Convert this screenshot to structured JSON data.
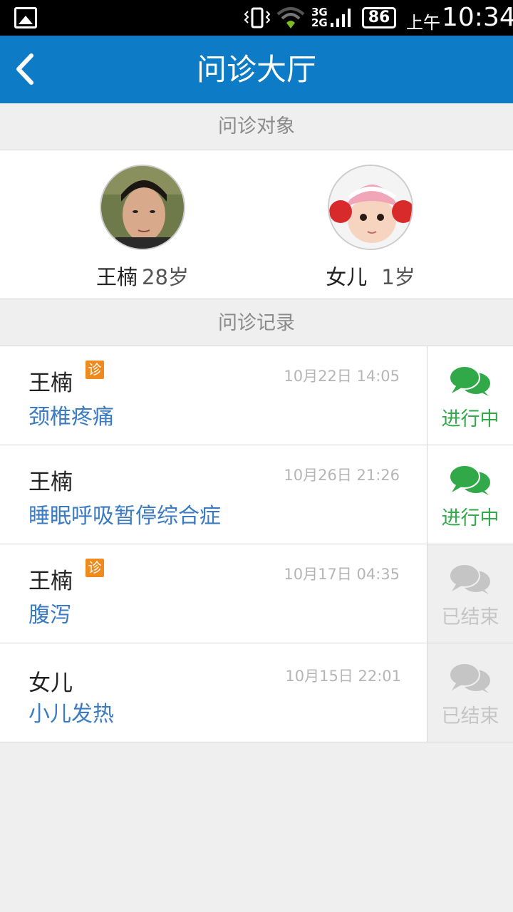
{
  "status_bar": {
    "network": "3G\n2G",
    "battery": "86",
    "ampm": "上午",
    "time": "10:34"
  },
  "header": {
    "title": "问诊大厅"
  },
  "patients_section": {
    "label": "问诊对象",
    "items": [
      {
        "name": "王楠",
        "age": "28岁"
      },
      {
        "name": "女儿",
        "age": "1岁"
      }
    ]
  },
  "records_section": {
    "label": "问诊记录",
    "items": [
      {
        "name": "王楠",
        "badge": "诊",
        "time": "10月22日 14:05",
        "diagnosis": "颈椎疼痛",
        "status": "进行中",
        "state": "active"
      },
      {
        "name": "王楠",
        "badge": "",
        "time": "10月26日 21:26",
        "diagnosis": "睡眠呼吸暂停综合症",
        "status": "进行中",
        "state": "active"
      },
      {
        "name": "王楠",
        "badge": "诊",
        "time": "10月17日 04:35",
        "diagnosis": "腹泻",
        "status": "已结束",
        "state": "ended"
      },
      {
        "name": "女儿",
        "badge": "",
        "time": "10月15日 22:01",
        "diagnosis": "小儿发热",
        "status": "已结束",
        "state": "ended"
      }
    ]
  },
  "colors": {
    "header_bg": "#0d7bc6",
    "active": "#31a948",
    "ended": "#c5c5c5",
    "diagnosis": "#3a7bc4",
    "badge": "#f08a1c"
  },
  "icons": [
    "gallery-icon",
    "vibrate-icon",
    "wifi-icon",
    "signal-icon",
    "battery-icon",
    "back-arrow-icon",
    "chat-bubbles-icon"
  ]
}
